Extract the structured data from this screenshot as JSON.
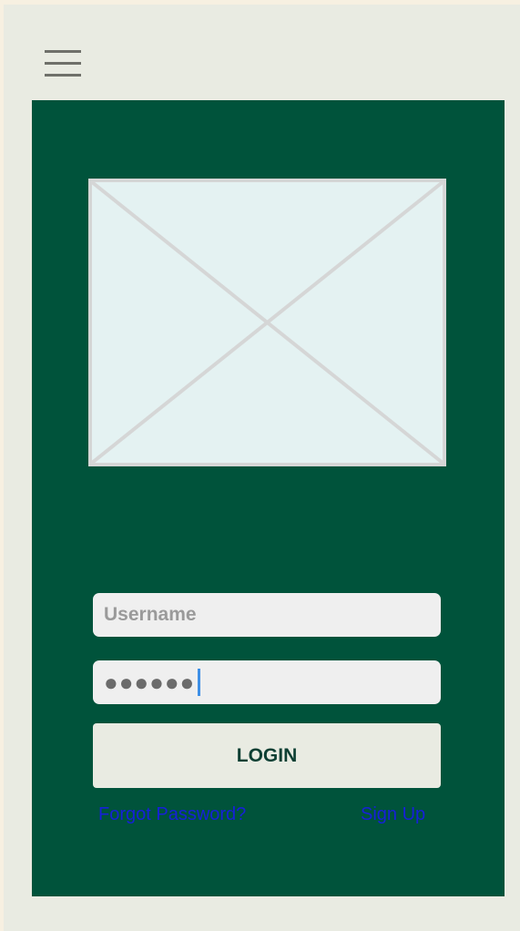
{
  "header": {
    "menu_icon": "hamburger-menu-icon"
  },
  "hero": {
    "image_icon": "image-placeholder-icon"
  },
  "login_form": {
    "username_placeholder": "Username",
    "password_value": "●●●●●●",
    "login_label": "LOGIN",
    "forgot_password_label": "Forgot Password?",
    "sign_up_label": "Sign Up"
  },
  "colors": {
    "page_background": "#e9ebe2",
    "panel_background": "#00533b",
    "input_background": "#efefef",
    "button_background": "#e9ebe2",
    "button_text": "#0d3f33",
    "link_text": "#1620d8",
    "caret": "#3e8fe6"
  }
}
